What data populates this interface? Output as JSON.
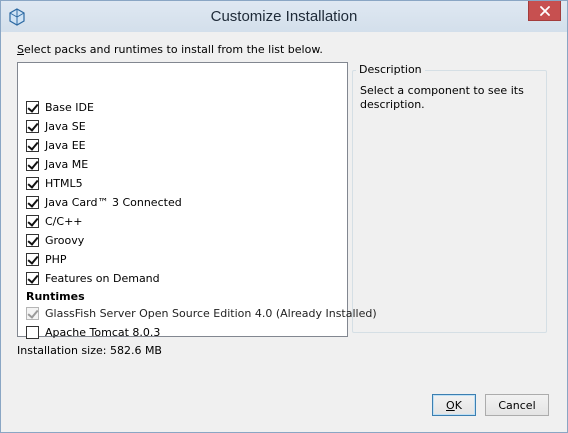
{
  "window": {
    "title": "Customize Installation"
  },
  "instruction": {
    "prefix": "S",
    "rest": "elect packs and runtimes to install from the list below."
  },
  "packs": [
    {
      "label": "Base IDE",
      "checked": true
    },
    {
      "label": "Java SE",
      "checked": true
    },
    {
      "label": "Java EE",
      "checked": true
    },
    {
      "label": "Java ME",
      "checked": true
    },
    {
      "label": "HTML5",
      "checked": true
    },
    {
      "label": "Java Card™ 3 Connected",
      "checked": true
    },
    {
      "label": "C/C++",
      "checked": true
    },
    {
      "label": "Groovy",
      "checked": true
    },
    {
      "label": "PHP",
      "checked": true
    },
    {
      "label": "Features on Demand",
      "checked": true
    }
  ],
  "runtimes_header": "Runtimes",
  "runtimes": [
    {
      "label": "GlassFish Server Open Source Edition 4.0  (Already Installed)",
      "checked": true,
      "disabled": true
    },
    {
      "label": "Apache Tomcat 8.0.3",
      "checked": false,
      "disabled": false
    }
  ],
  "description": {
    "legend": "Description",
    "text": "Select a component to see its description."
  },
  "install_size": "Installation size: 582.6 MB",
  "buttons": {
    "ok_mnemonic": "O",
    "ok_rest": "K",
    "cancel": "Cancel"
  },
  "icons": {
    "app": "netbeans-icon",
    "close": "close-icon"
  }
}
